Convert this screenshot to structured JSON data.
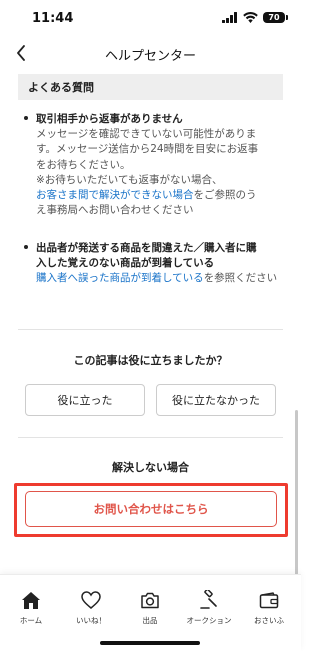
{
  "status_bar": {
    "time": "11:44",
    "battery": "70"
  },
  "nav": {
    "title": "ヘルプセンター"
  },
  "faq": {
    "header": "よくある質問",
    "items": [
      {
        "title_lines": [
          "取引相手から返事がありません"
        ],
        "text_lines": [
          "メッセージを確認できていない可能性がありま",
          "す。メッセージ送信から24時間を目安にお返事",
          "をお待ちください。",
          "※お待ちいただいても返事がない場合、"
        ],
        "link_text": "お客さま間で解決ができない場合",
        "after_link": "をご参照のう",
        "tail_line": "え事務局へお問い合わせください"
      },
      {
        "title_lines": [
          "出品者が発送する商品を間違えた／購入者に購",
          "入した覚えのない商品が到着している"
        ],
        "link_text": "購入者へ誤った商品が到着している",
        "after_link": "を参照ください"
      }
    ]
  },
  "feedback": {
    "question": "この記事は役に立ちましたか？",
    "yes": "役に立った",
    "no": "役に立たなかった"
  },
  "unsolved": {
    "label": "解決しない場合",
    "contact_button": "お問い合わせはこちら"
  },
  "tabs": [
    {
      "label": "ホーム",
      "icon": "home-icon"
    },
    {
      "label": "いいね！",
      "icon": "heart-icon"
    },
    {
      "label": "出品",
      "icon": "camera-icon"
    },
    {
      "label": "オークション",
      "icon": "gavel-icon"
    },
    {
      "label": "おさいふ",
      "icon": "wallet-icon"
    }
  ],
  "colors": {
    "accent": "#e0554a",
    "highlight": "#ee3b2f",
    "link": "#1b74c9"
  }
}
